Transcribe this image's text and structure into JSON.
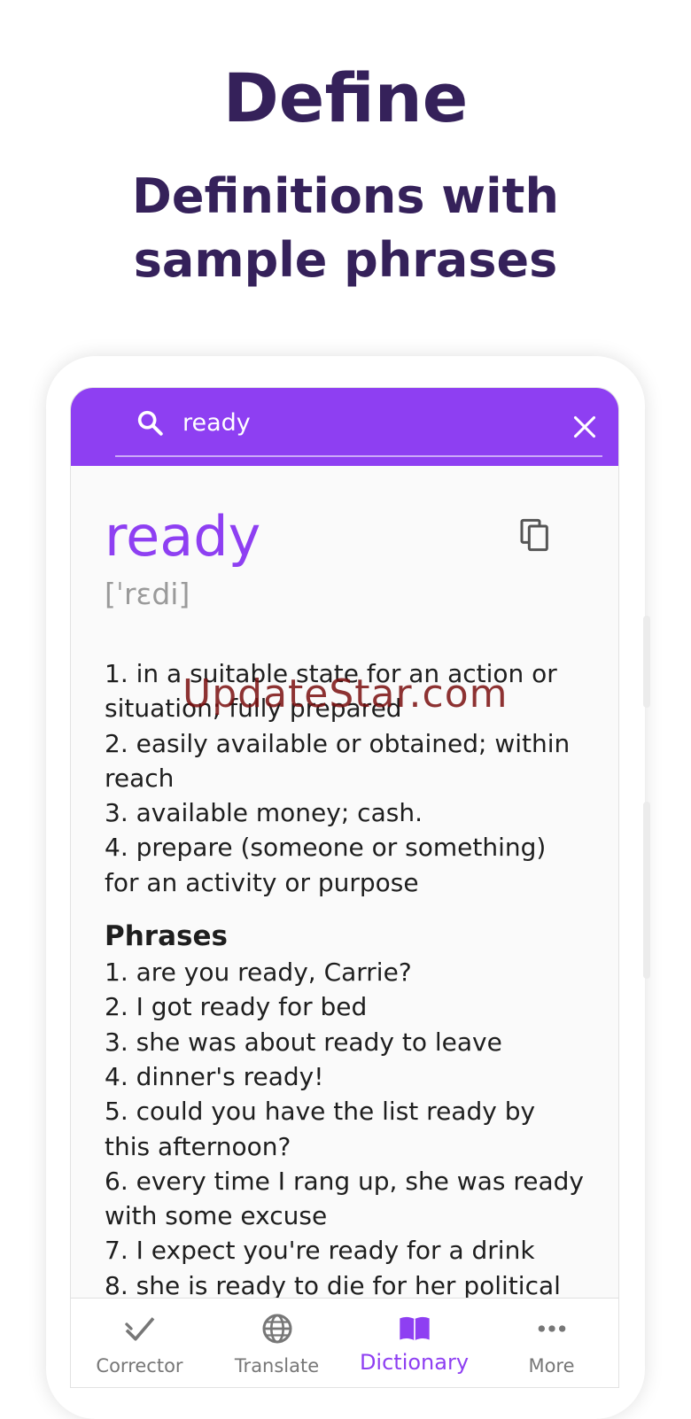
{
  "promo": {
    "title": "Define",
    "subtitle_line1": "Definitions with",
    "subtitle_line2": "sample phrases"
  },
  "search": {
    "value": "ready",
    "search_icon": "search-icon",
    "clear_icon": "close-icon"
  },
  "entry": {
    "word": "ready",
    "pronunciation": "[ˈrɛdi]",
    "copy_icon": "copy-icon",
    "definitions": [
      "1. in a suitable state for an action or",
      "situation; fully prepared",
      "2. easily available or obtained; within",
      "reach",
      "3. available money; cash.",
      "4. prepare (someone or something)",
      "for an activity or purpose"
    ],
    "phrases_heading": "Phrases",
    "phrases": [
      "1. are you ready, Carrie?",
      "2. I got ready for bed",
      "3. she was about ready to leave",
      "4. dinner's ready!",
      "5. could you have the list ready by",
      "this afternoon?",
      "6. every time I rang up, she was ready",
      "with some excuse",
      "7. I expect you're ready for a drink",
      "8. she is ready to die for her political"
    ]
  },
  "watermark": "UpdateStar.com",
  "bottom_nav": {
    "items": [
      {
        "label": "Corrector",
        "icon": "check-icon",
        "active": false
      },
      {
        "label": "Translate",
        "icon": "globe-icon",
        "active": false
      },
      {
        "label": "Dictionary",
        "icon": "book-icon",
        "active": true
      },
      {
        "label": "More",
        "icon": "more-dots-icon",
        "active": false
      }
    ]
  },
  "colors": {
    "accent": "#8e3ff2",
    "title": "#35215a",
    "text": "#1e1e1e",
    "muted": "#777777"
  }
}
